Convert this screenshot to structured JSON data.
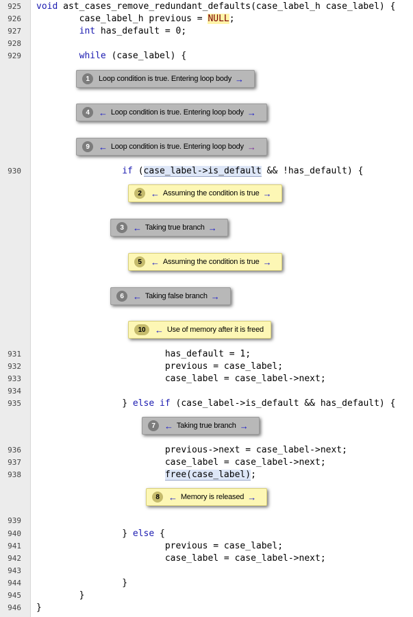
{
  "code_lines": [
    {
      "n": "925",
      "code": "void ast_cases_remove_redundant_defaults(case_label_h case_label) {"
    },
    {
      "n": "926",
      "code": "        case_label_h previous = NULL;"
    },
    {
      "n": "927",
      "code": "        int has_default = 0;"
    },
    {
      "n": "928",
      "code": ""
    },
    {
      "n": "929",
      "code": "        while (case_label) {"
    },
    {
      "n": "930",
      "code": "                if (case_label->is_default && !has_default) {"
    },
    {
      "n": "931",
      "code": "                        has_default = 1;"
    },
    {
      "n": "932",
      "code": "                        previous = case_label;"
    },
    {
      "n": "933",
      "code": "                        case_label = case_label->next;"
    },
    {
      "n": "934",
      "code": ""
    },
    {
      "n": "935",
      "code": "                } else if (case_label->is_default && has_default) {"
    },
    {
      "n": "936",
      "code": "                        previous->next = case_label->next;"
    },
    {
      "n": "937",
      "code": "                        case_label = case_label->next;"
    },
    {
      "n": "938",
      "code": "                        free(case_label);"
    },
    {
      "n": "939",
      "code": ""
    },
    {
      "n": "940",
      "code": "                } else {"
    },
    {
      "n": "941",
      "code": "                        previous = case_label;"
    },
    {
      "n": "942",
      "code": "                        case_label = case_label->next;"
    },
    {
      "n": "943",
      "code": ""
    },
    {
      "n": "944",
      "code": "                }"
    },
    {
      "n": "945",
      "code": "        }"
    },
    {
      "n": "946",
      "code": "}"
    }
  ],
  "messages": [
    {
      "num": "1",
      "text": "Loop condition is true.  Entering loop body"
    },
    {
      "num": "4",
      "text": "Loop condition is true.  Entering loop body"
    },
    {
      "num": "9",
      "text": "Loop condition is true.  Entering loop body"
    },
    {
      "num": "2",
      "text": "Assuming the condition is true"
    },
    {
      "num": "3",
      "text": "Taking true branch"
    },
    {
      "num": "5",
      "text": "Assuming the condition is true"
    },
    {
      "num": "6",
      "text": "Taking false branch"
    },
    {
      "num": "10",
      "text": "Use of memory after it is freed"
    },
    {
      "num": "7",
      "text": "Taking true branch"
    },
    {
      "num": "8",
      "text": "Memory is released"
    }
  ],
  "glyphs": {
    "left_arrow": "←",
    "right_arrow": "→"
  },
  "colors": {
    "control_bubble": "#b8b8b8",
    "event_bubble": "#fdf7b5",
    "arrow": "#1414c8",
    "gutter": "#ececec"
  }
}
